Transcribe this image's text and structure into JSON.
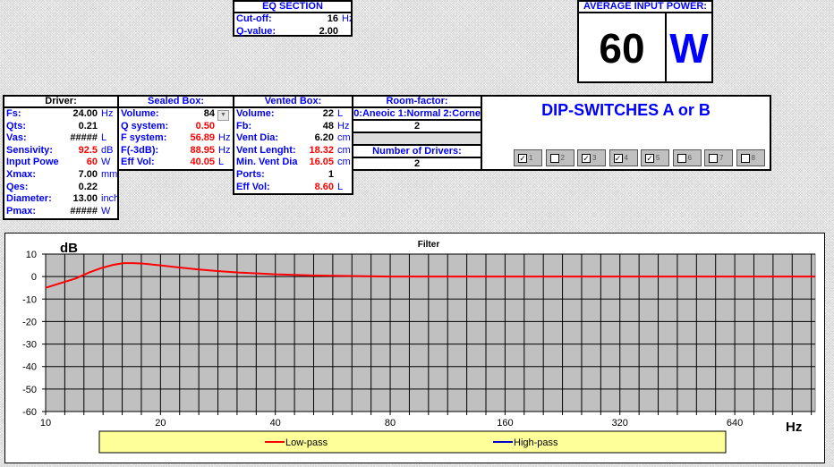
{
  "eq": {
    "title": "EQ SECTION",
    "rows": [
      {
        "label": "Cut-off:",
        "value": "16",
        "unit": "Hz"
      },
      {
        "label": "Q-value:",
        "value": "2.00",
        "unit": ""
      }
    ]
  },
  "power": {
    "title": "AVERAGE INPUT POWER:",
    "value": "60",
    "unit": "W"
  },
  "driver": {
    "title": "Driver:",
    "rows": [
      {
        "label": "Fs:",
        "value": "24.00",
        "unit": "Hz",
        "red": false
      },
      {
        "label": "Qts:",
        "value": "0.21",
        "unit": "",
        "red": false
      },
      {
        "label": "Vas:",
        "value": "#####",
        "unit": "L",
        "red": false
      },
      {
        "label": "Sensivity:",
        "value": "92.5",
        "unit": "dB",
        "red": true
      },
      {
        "label": "Input Powe",
        "value": "60",
        "unit": "W",
        "red": true
      },
      {
        "label": "Xmax:",
        "value": "7.00",
        "unit": "mm",
        "red": false
      },
      {
        "label": "Qes:",
        "value": "0.22",
        "unit": "",
        "red": false
      },
      {
        "label": "Diameter:",
        "value": "13.00",
        "unit": "inch",
        "red": false
      },
      {
        "label": "Pmax:",
        "value": "#####",
        "unit": "W",
        "red": false
      }
    ]
  },
  "sealed": {
    "title": "Sealed Box:",
    "rows": [
      {
        "label": "Volume:",
        "value": "84",
        "unit": "",
        "red": false
      },
      {
        "label": "Q system:",
        "value": "0.50",
        "unit": "",
        "red": true
      },
      {
        "label": "F system:",
        "value": "56.89",
        "unit": "Hz",
        "red": true
      },
      {
        "label": "F(-3dB):",
        "value": "88.95",
        "unit": "Hz",
        "red": true
      },
      {
        "label": "Eff Vol:",
        "value": "40.05",
        "unit": "L",
        "red": true
      }
    ]
  },
  "vented": {
    "title": "Vented Box:",
    "rows": [
      {
        "label": "Volume:",
        "value": "22",
        "unit": "L",
        "red": false
      },
      {
        "label": "Fb:",
        "value": "48",
        "unit": "Hz",
        "red": false
      },
      {
        "label": "Vent Dia:",
        "value": "6.20",
        "unit": "cm",
        "red": false
      },
      {
        "label": "Vent Lenght:",
        "value": "18.32",
        "unit": "cm",
        "red": true
      },
      {
        "label": "Min. Vent Dia",
        "value": "16.05",
        "unit": "cm",
        "red": true
      },
      {
        "label": "Ports:",
        "value": "1",
        "unit": "",
        "red": false
      },
      {
        "label": "Eff Vol:",
        "value": "8.60",
        "unit": "L",
        "red": true
      }
    ]
  },
  "room": {
    "title": "Room-factor:",
    "options": "0:Aneoic 1:Normal 2:Corne",
    "value": "2",
    "drivers_title": "Number of Drivers:",
    "drivers_value": "2"
  },
  "dip": {
    "title": "DIP-SWITCHES A or B",
    "switches": [
      {
        "label": "1",
        "checked": true
      },
      {
        "label": "2",
        "checked": false
      },
      {
        "label": "3",
        "checked": true
      },
      {
        "label": "4",
        "checked": true
      },
      {
        "label": "5",
        "checked": true
      },
      {
        "label": "6",
        "checked": false
      },
      {
        "label": "7",
        "checked": false
      },
      {
        "label": "8",
        "checked": false
      }
    ]
  },
  "colors": {
    "lowpass": "#ff0000",
    "highpass": "#0000cc",
    "plot_bg": "#c0c0c0",
    "legend_bg": "#ffff99"
  },
  "chart_data": {
    "type": "line",
    "title": "Filter",
    "ylabel": "dB",
    "xlabel": "Hz",
    "xscale": "log2",
    "xlim": [
      10,
      1040
    ],
    "ylim": [
      -60,
      10
    ],
    "yticks": [
      10,
      0,
      -10,
      -20,
      -30,
      -40,
      -50,
      -60
    ],
    "xticks": [
      10,
      20,
      40,
      80,
      160,
      320,
      640
    ],
    "grid": true,
    "legend": "bottom",
    "series": [
      {
        "name": "Low-pass",
        "color": "#ff0000",
        "x": [
          10,
          11,
          12,
          13,
          14,
          15,
          16,
          17,
          18,
          20,
          22,
          25,
          28,
          32,
          36,
          40,
          50,
          60,
          80,
          120,
          200,
          400,
          1040
        ],
        "y": [
          -5,
          -2.8,
          -0.8,
          1.8,
          3.8,
          5.2,
          6,
          6,
          5.8,
          5,
          4.2,
          3.2,
          2.5,
          1.8,
          1.4,
          1,
          0.5,
          0.3,
          0,
          0,
          0,
          0,
          0
        ]
      },
      {
        "name": "High-pass",
        "color": "#0000cc",
        "x": [],
        "y": []
      }
    ]
  }
}
